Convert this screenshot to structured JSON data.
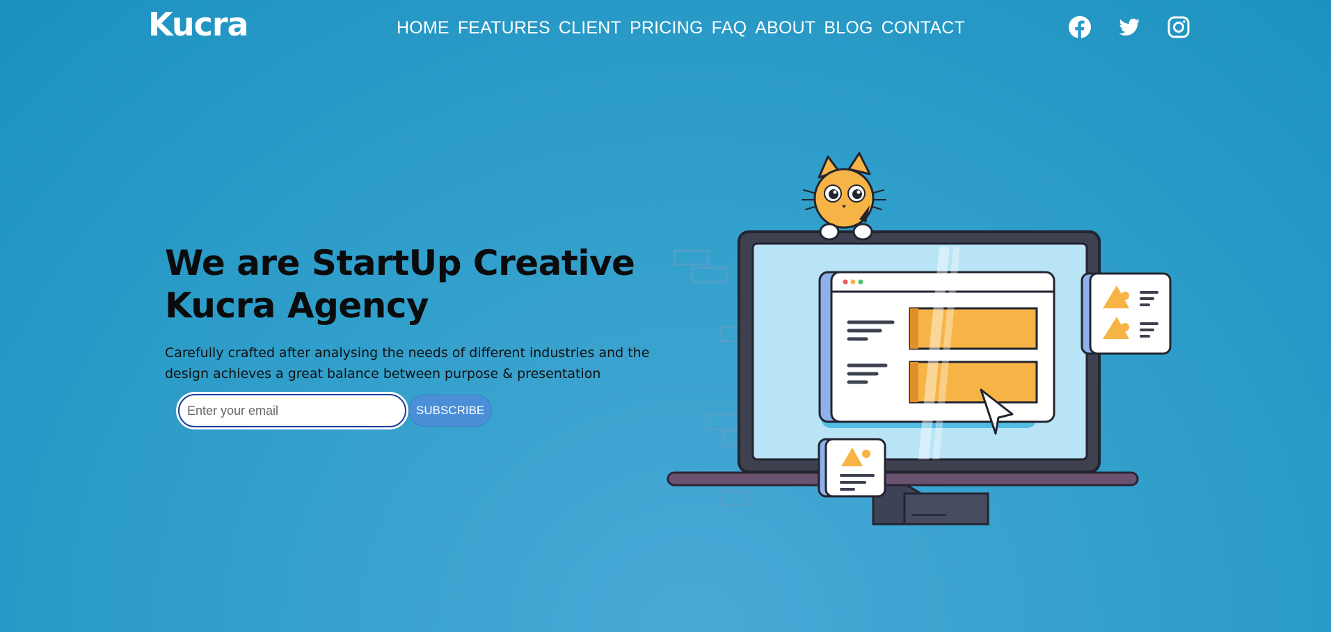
{
  "brand": {
    "logo": "Kucra"
  },
  "nav": {
    "items": [
      "HOME",
      "FEATURES",
      "CLIENT",
      "PRICING",
      "FAQ",
      "ABOUT",
      "BLOG",
      "CONTACT"
    ]
  },
  "social": {
    "icons": [
      "facebook-icon",
      "twitter-icon",
      "instagram-icon"
    ]
  },
  "hero": {
    "title_line1": "We are StartUp Creative",
    "title_line2": "Kucra Agency",
    "description": "Carefully crafted after analysing the needs of different industries and the design achieves a great balance between purpose & presentation"
  },
  "subscribe": {
    "placeholder": "Enter your email",
    "button_label": "SUBSCRIBE"
  },
  "colors": {
    "background": "#2a9ac8",
    "accent_orange": "#f7b446",
    "button_blue": "#4a8fd8",
    "dark_outline": "#3d4150"
  }
}
